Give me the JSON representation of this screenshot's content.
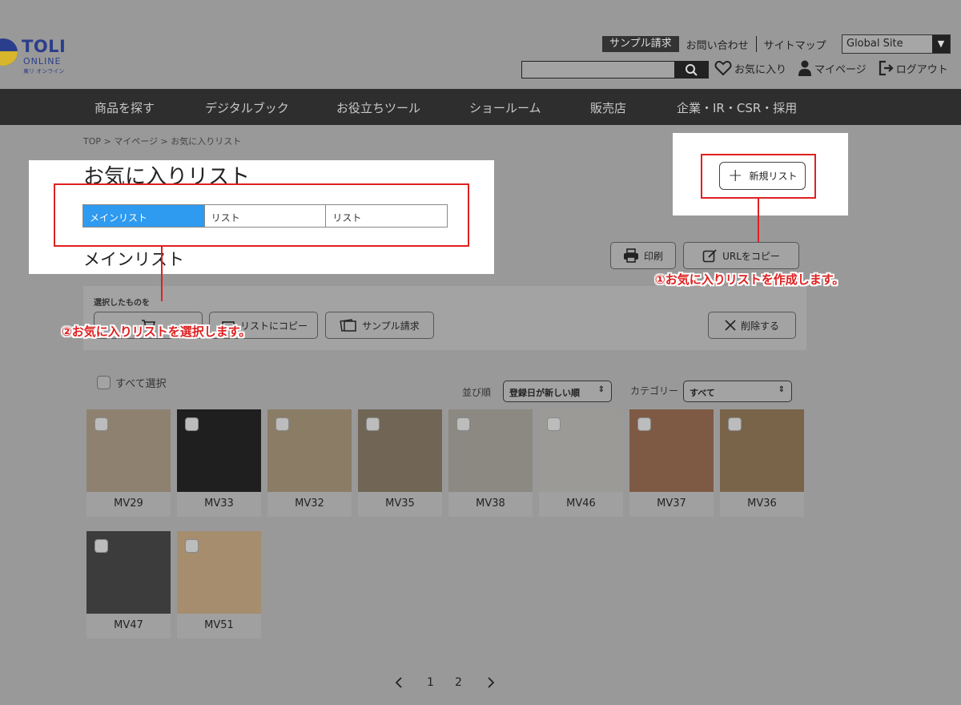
{
  "header": {
    "logo": {
      "line1": "TOLI",
      "line2": "ONLINE",
      "line3": "東リ オンライン"
    },
    "top_links": {
      "sample": "サンプル請求",
      "contact": "お問い合わせ",
      "sitemap": "サイトマップ"
    },
    "global_site": "Global Site",
    "search": {
      "placeholder": ""
    },
    "favorites": "お気に入り",
    "mypage": "マイページ",
    "logout": "ログアウト"
  },
  "nav": {
    "items": [
      "商品を探す",
      "デジタルブック",
      "お役立ちツール",
      "ショールーム",
      "販売店",
      "企業・IR・CSR・採用"
    ]
  },
  "breadcrumb": "TOP > マイページ > お気に入りリスト",
  "page": {
    "title": "お気に入りリスト",
    "tabs": [
      "メインリスト",
      "リスト",
      "リスト"
    ],
    "subtitle": "メインリスト",
    "new_list_button": "新規リスト",
    "print_button": "印刷",
    "copy_url_button": "URLをコピー"
  },
  "selection_bar": {
    "label": "選択したものを",
    "copy_list_button": "リストにコピー",
    "sample_button": "サンプル請求",
    "delete_button": "削除する"
  },
  "callouts": {
    "create": "①お気に入りリストを作成します。",
    "select": "②お気に入りリストを選択します。"
  },
  "filters": {
    "select_all": "すべて選択",
    "sort_label": "並び順",
    "sort_value": "登録日が新しい順",
    "category_label": "カテゴリー",
    "category_value": "すべて"
  },
  "products": [
    {
      "name": "MV29",
      "color": "#8e8170"
    },
    {
      "name": "MV33",
      "color": "#1f1f1f"
    },
    {
      "name": "MV32",
      "color": "#8b7c66"
    },
    {
      "name": "MV35",
      "color": "#716656"
    },
    {
      "name": "MV38",
      "color": "#8c8983"
    },
    {
      "name": "MV46",
      "color": "#9b9a96"
    },
    {
      "name": "MV37",
      "color": "#7e5a44"
    },
    {
      "name": "MV36",
      "color": "#7a6449"
    },
    {
      "name": "MV47",
      "color": "#3c3c3c"
    },
    {
      "name": "MV51",
      "color": "#a58d6d"
    }
  ],
  "pagination": {
    "prev": "<",
    "pages": [
      "1",
      "2"
    ],
    "next": ">"
  }
}
